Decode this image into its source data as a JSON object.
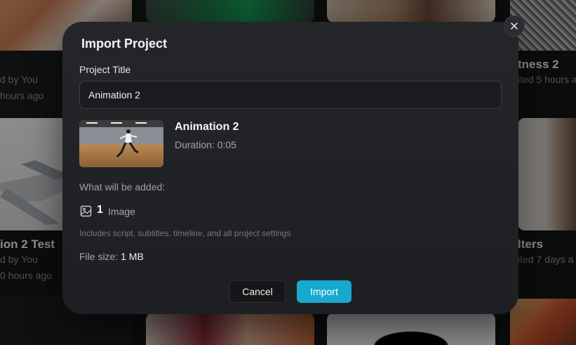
{
  "background": {
    "cards": [
      {
        "title": "",
        "line1": "d by You",
        "line2": "hours ago"
      },
      {
        "title": "tness 2",
        "line1": "ited 5 hours a"
      },
      {
        "title": "ion 2 Test",
        "line1": "d by You",
        "line2": "0 hours ago"
      },
      {
        "title": "lters",
        "line1": "ited 7 days a"
      }
    ]
  },
  "modal": {
    "title": "Import Project",
    "field_label": "Project Title",
    "title_value": "Animation 2",
    "project_name": "Animation 2",
    "duration": "Duration: 0:05",
    "added_label": "What will be added:",
    "image_count": "1",
    "image_label": "Image",
    "image_icon": "image-icon",
    "includes_text": "Includes script, subtitles, timeline, and all project settings",
    "filesize_label": "File size: ",
    "filesize_value": "1 MB",
    "cancel_label": "Cancel",
    "import_label": "Import",
    "close_icon": "close-icon"
  },
  "colors": {
    "accent": "#18a9cf",
    "modal_bg": "#242629",
    "page_bg": "#141516"
  }
}
